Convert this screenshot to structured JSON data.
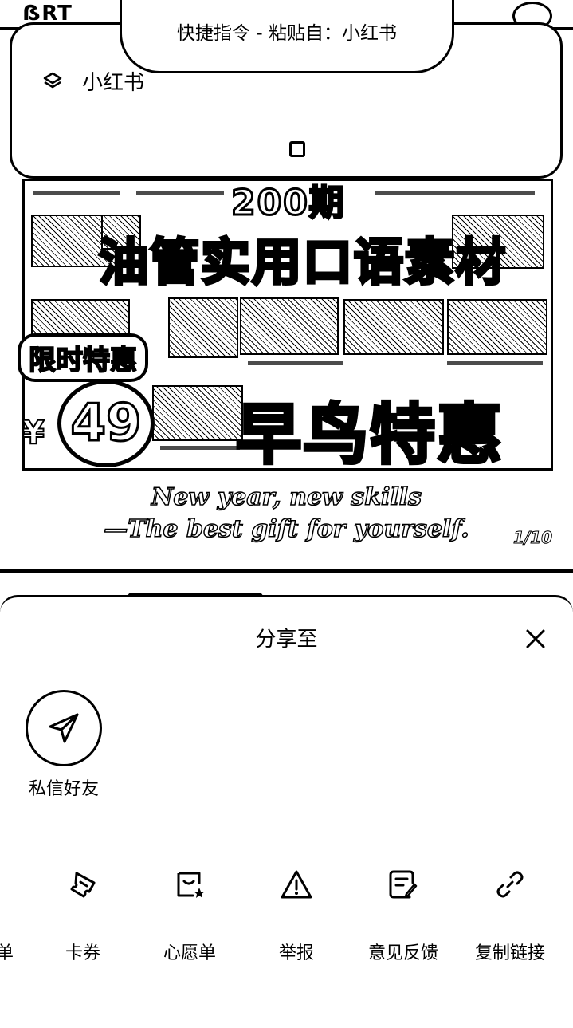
{
  "hero": {
    "logo_text": "ẞRT",
    "count_text": "200期",
    "headline": "油管实用口语素材",
    "promo_badge": "限时特惠",
    "currency": "¥",
    "price": "49",
    "early_bird": "早鸟特惠",
    "tagline_line1": "New year, new skills",
    "tagline_line2": "—The best gift for yourself.",
    "page_indicator": "1/10"
  },
  "paste_notice": {
    "title": "快捷指令 - 粘贴自：小红书",
    "app_name": "小红书",
    "app_icon": "shortcuts-icon"
  },
  "share_sheet": {
    "title": "分享至",
    "close_icon": "close-icon",
    "contact": {
      "label": "私信好友",
      "icon": "send-icon"
    },
    "actions": [
      {
        "label": "单",
        "icon": "list-icon"
      },
      {
        "label": "卡券",
        "icon": "ticket-icon"
      },
      {
        "label": "心愿单",
        "icon": "wishlist-icon"
      },
      {
        "label": "举报",
        "icon": "warning-icon"
      },
      {
        "label": "意见反馈",
        "icon": "feedback-icon"
      },
      {
        "label": "复制链接",
        "icon": "link-icon"
      }
    ]
  }
}
